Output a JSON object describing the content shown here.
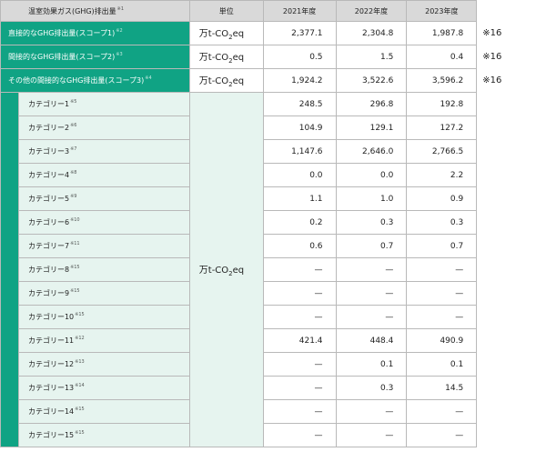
{
  "header": {
    "item": "温室効果ガス(GHG)排出量",
    "item_note": "※1",
    "unit": "単位",
    "years": [
      "2021年度",
      "2022年度",
      "2023年度"
    ]
  },
  "unit_text": {
    "prefix": "万t-CO",
    "subscript": "2",
    "suffix": "eq"
  },
  "scopes": [
    {
      "label": "直接的なGHG排出量(スコープ1)",
      "note": "※2",
      "values": [
        "2,377.1",
        "2,304.8",
        "1,987.8"
      ],
      "remark": "※16"
    },
    {
      "label": "間接的なGHG排出量(スコープ2)",
      "note": "※3",
      "values": [
        "0.5",
        "1.5",
        "0.4"
      ],
      "remark": "※16"
    },
    {
      "label": "その他の間接的なGHG排出量(スコープ3)",
      "note": "※4",
      "values": [
        "1,924.2",
        "3,522.6",
        "3,596.2"
      ],
      "remark": "※16"
    }
  ],
  "categories": [
    {
      "label": "カテゴリー1",
      "note": "※5",
      "values": [
        "248.5",
        "296.8",
        "192.8"
      ]
    },
    {
      "label": "カテゴリー2",
      "note": "※6",
      "values": [
        "104.9",
        "129.1",
        "127.2"
      ]
    },
    {
      "label": "カテゴリー3",
      "note": "※7",
      "values": [
        "1,147.6",
        "2,646.0",
        "2,766.5"
      ]
    },
    {
      "label": "カテゴリー4",
      "note": "※8",
      "values": [
        "0.0",
        "0.0",
        "2.2"
      ]
    },
    {
      "label": "カテゴリー5",
      "note": "※9",
      "values": [
        "1.1",
        "1.0",
        "0.9"
      ]
    },
    {
      "label": "カテゴリー6",
      "note": "※10",
      "values": [
        "0.2",
        "0.3",
        "0.3"
      ]
    },
    {
      "label": "カテゴリー7",
      "note": "※11",
      "values": [
        "0.6",
        "0.7",
        "0.7"
      ]
    },
    {
      "label": "カテゴリー8",
      "note": "※15",
      "values": [
        "—",
        "—",
        "—"
      ]
    },
    {
      "label": "カテゴリー9",
      "note": "※15",
      "values": [
        "—",
        "—",
        "—"
      ]
    },
    {
      "label": "カテゴリー10",
      "note": "※15",
      "values": [
        "—",
        "—",
        "—"
      ]
    },
    {
      "label": "カテゴリー11",
      "note": "※12",
      "values": [
        "421.4",
        "448.4",
        "490.9"
      ]
    },
    {
      "label": "カテゴリー12",
      "note": "※13",
      "values": [
        "—",
        "0.1",
        "0.1"
      ]
    },
    {
      "label": "カテゴリー13",
      "note": "※14",
      "values": [
        "—",
        "0.3",
        "14.5"
      ]
    },
    {
      "label": "カテゴリー14",
      "note": "※15",
      "values": [
        "—",
        "—",
        "—"
      ]
    },
    {
      "label": "カテゴリー15",
      "note": "※15",
      "values": [
        "—",
        "—",
        "—"
      ]
    }
  ]
}
